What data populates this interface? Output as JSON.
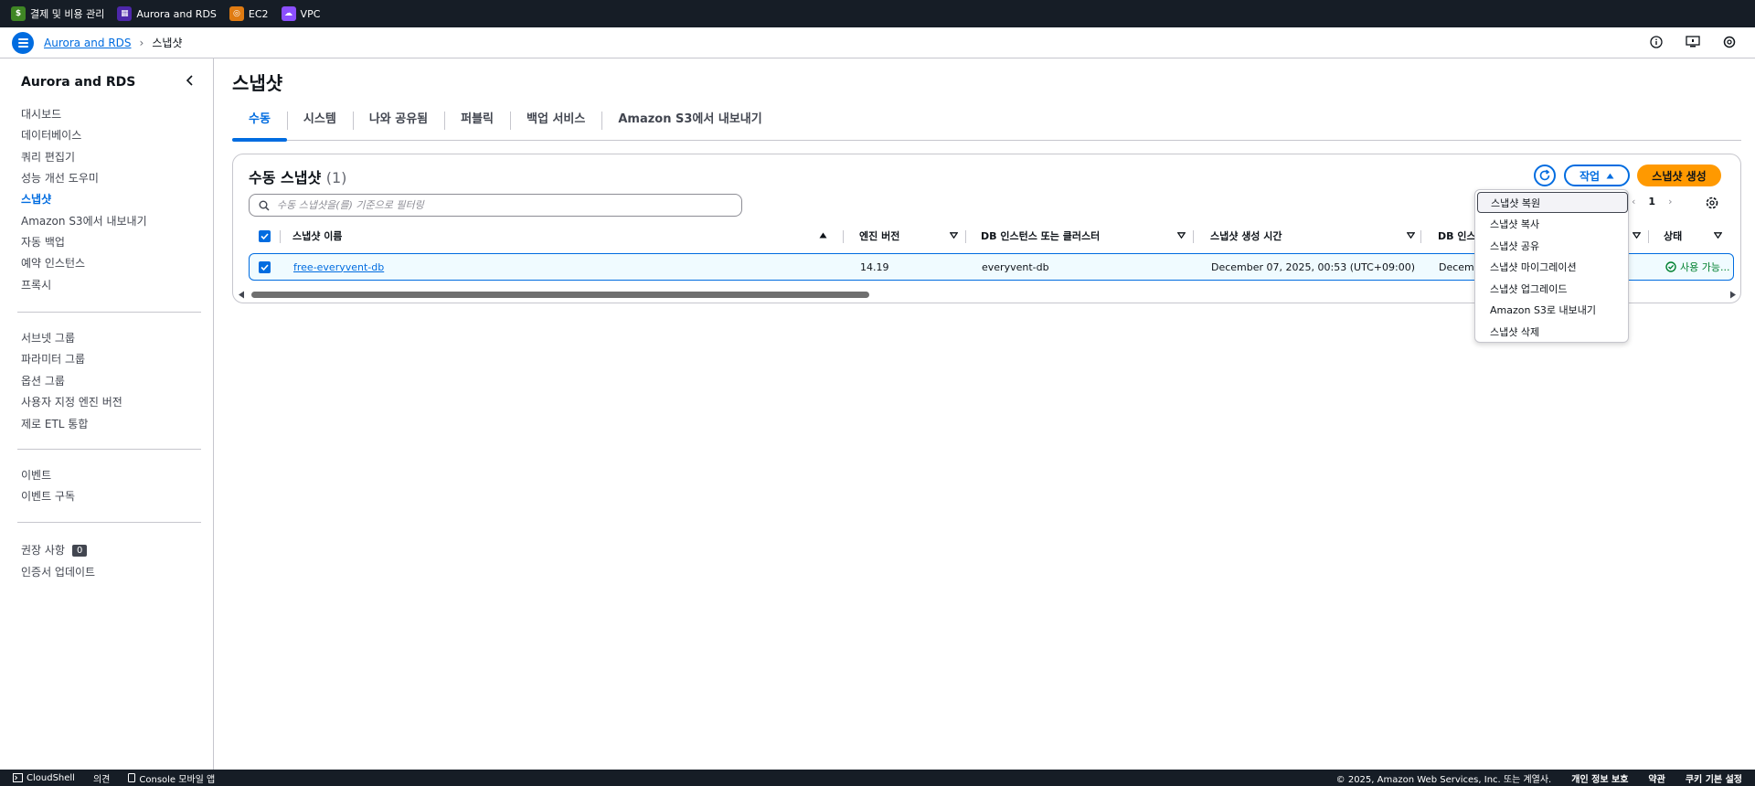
{
  "topbar": {
    "favorites": [
      {
        "label": "결제 및 비용 관리",
        "icon": "billing-icon",
        "color": "#3f8624"
      },
      {
        "label": "Aurora and RDS",
        "icon": "rds-icon",
        "color": "#4d27aa"
      },
      {
        "label": "EC2",
        "icon": "ec2-icon",
        "color": "#e07b12"
      },
      {
        "label": "VPC",
        "icon": "vpc-icon",
        "color": "#8c4fff"
      }
    ]
  },
  "breadcrumb": {
    "parent": "Aurora and RDS",
    "current": "스냅샷"
  },
  "sidebar": {
    "title": "Aurora and RDS",
    "group1": [
      "대시보드",
      "데이터베이스",
      "쿼리 편집기",
      "성능 개선 도우미",
      "스냅샷",
      "Amazon S3에서 내보내기",
      "자동 백업",
      "예약 인스턴스",
      "프록시"
    ],
    "active": "스냅샷",
    "group2": [
      "서브넷 그룹",
      "파라미터 그룹",
      "옵션 그룹",
      "사용자 지정 엔진 버전",
      "제로 ETL 통합"
    ],
    "group3": [
      "이벤트",
      "이벤트 구독"
    ],
    "recommendations": "권장 사항",
    "recommendations_count": "0",
    "cert_update": "인증서 업데이트"
  },
  "page": {
    "title": "스냅샷",
    "tabs": [
      "수동",
      "시스템",
      "나와 공유됨",
      "퍼블릭",
      "백업 서비스",
      "Amazon S3에서 내보내기"
    ],
    "active_tab": "수동"
  },
  "panel": {
    "title": "수동 스냅샷",
    "count": "(1)",
    "actions_label": "작업",
    "create_label": "스냅샷 생성",
    "search_placeholder": "수동 스냅샷을(를) 기준으로 필터링",
    "page_number": "1",
    "columns": [
      "스냅샷 이름",
      "엔진 버전",
      "DB 인스턴스 또는 클러스터",
      "스냅샷 생성 시간",
      "DB 인스",
      "상태"
    ],
    "rows": [
      {
        "name": "free-everyvent-db",
        "engine_version": "14.19",
        "db_instance": "everyvent-db",
        "created": "December 07, 2025, 00:53 (UTC+09:00)",
        "db_inst_truncated": "Decemb",
        "status": "사용 가능..."
      }
    ]
  },
  "actions_menu": {
    "items": [
      "스냅샷 복원",
      "스냅샷 복사",
      "스냅샷 공유",
      "스냅샷 마이그레이션",
      "스냅샷 업그레이드",
      "Amazon S3로 내보내기",
      "스냅샷 삭제"
    ],
    "focused": "스냅샷 복원"
  },
  "footer": {
    "cloudshell": "CloudShell",
    "feedback": "의견",
    "console_mobile": "Console 모바일 앱",
    "copyright": "© 2025, Amazon Web Services, Inc. 또는 계열사.",
    "privacy": "개인 정보 보호",
    "terms": "약관",
    "cookies": "쿠키 기본 설정"
  },
  "colors": {
    "accent": "#006ce0",
    "primary_button": "#ff9900",
    "success": "#00802f",
    "topbar": "#161d26"
  }
}
